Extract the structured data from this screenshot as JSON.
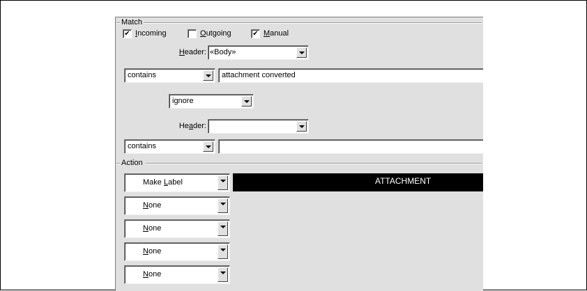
{
  "match": {
    "label": "Match",
    "checkboxes": [
      {
        "pre": "",
        "u": "I",
        "post": "ncoming",
        "checked": true,
        "mark": "✔"
      },
      {
        "pre": "",
        "u": "O",
        "post": "utgoing",
        "checked": false,
        "mark": ""
      },
      {
        "pre": "",
        "u": "M",
        "post": "anual",
        "checked": true,
        "mark": "✔"
      }
    ],
    "header1": {
      "pre": "",
      "u": "H",
      "post": "eader:",
      "value": "«Body»"
    },
    "condition1": {
      "op": "contains",
      "value": "attachment converted"
    },
    "conjunction": "ignore",
    "header2": {
      "pre": "He",
      "u": "a",
      "post": "der:",
      "value": ""
    },
    "condition2": {
      "op": "contains",
      "value": ""
    }
  },
  "action": {
    "label": "Action",
    "rows": [
      {
        "pre": "Make ",
        "u": "L",
        "post": "abel",
        "value": "ATTACHMENT"
      },
      {
        "pre": "",
        "u": "N",
        "post": "one"
      },
      {
        "pre": "",
        "u": "N",
        "post": "one"
      },
      {
        "pre": "",
        "u": "N",
        "post": "one"
      },
      {
        "pre": "",
        "u": "N",
        "post": "one"
      }
    ]
  },
  "colors": {
    "panel": "#e0e0e0",
    "label_bg": "#000000",
    "label_fg": "#ffffff"
  }
}
